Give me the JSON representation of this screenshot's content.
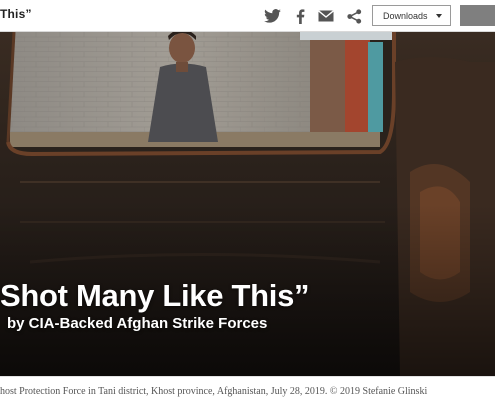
{
  "header": {
    "breadcrumb": "This”",
    "downloads_label": "Downloads",
    "icons": [
      "twitter-icon",
      "facebook-icon",
      "email-icon",
      "share-icon"
    ]
  },
  "hero": {
    "title": "Shot Many Like This”",
    "subtitle": "by CIA-Backed Afghan Strike Forces"
  },
  "caption": {
    "text": "host Protection Force in Tani district, Khost province, Afghanistan, July 28, 2019. © 2019 Stefanie Glinski"
  },
  "colors": {
    "icon": "#555555",
    "hero_overlay": "#1e1a17",
    "title_text": "#ffffff",
    "caption_text": "#555555"
  }
}
